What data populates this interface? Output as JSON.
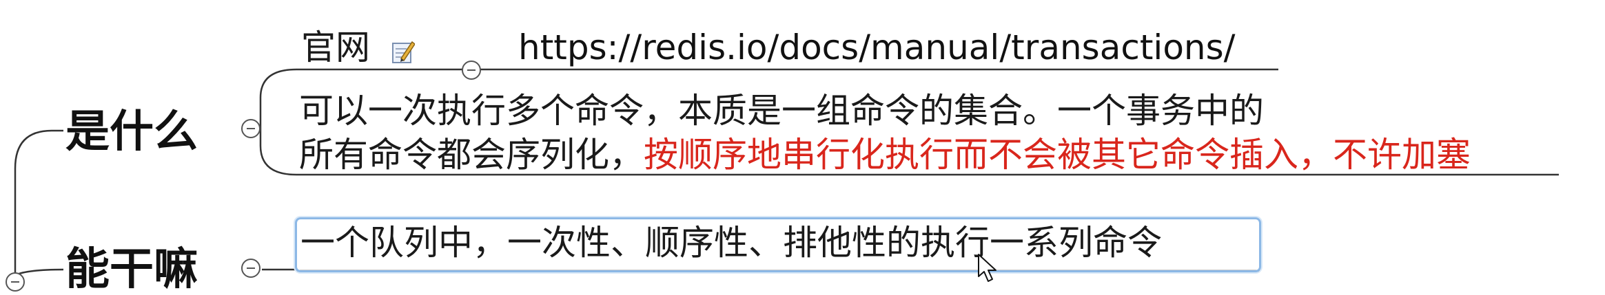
{
  "nodes": {
    "what": {
      "title": "是什么",
      "official_site_label": "官网",
      "url": "https://redis.io/docs/manual/transactions/",
      "description_line1": "可以一次执行多个命令，本质是一组命令的集合。一个事务中的",
      "description_line2_black": "所有命令都会序列化，",
      "description_line2_red": "按顺序地串行化执行而不会被其它命令插入，不许加塞"
    },
    "can_do": {
      "title": "能干嘛",
      "description": "一个队列中，一次性、顺序性、排他性的执行一系列命令"
    }
  },
  "icons": {
    "note": "note-pencil-icon",
    "collapse": "collapse-minus-icon",
    "cursor": "mouse-pointer-icon"
  },
  "colors": {
    "branch_line": "#333333",
    "highlight_text": "#d9261c",
    "selection_border": "#8cb8e6"
  }
}
